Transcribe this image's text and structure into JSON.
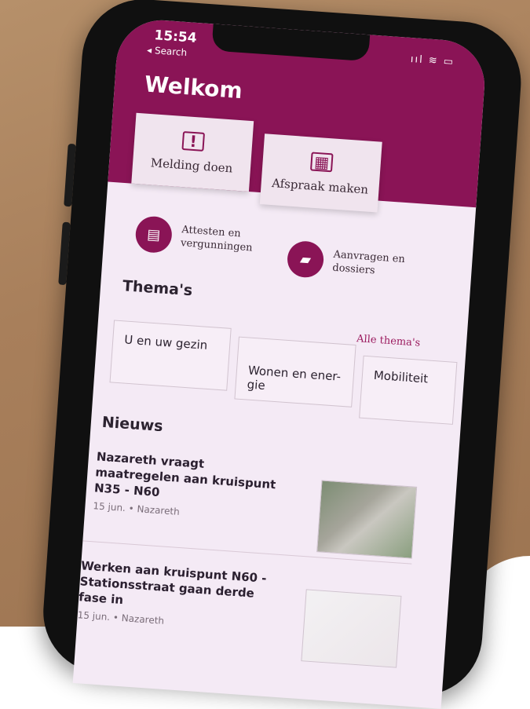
{
  "status": {
    "time": "15:54",
    "back": "◂ Search",
    "icons": "ııl ≋ ▭"
  },
  "header": {
    "title": "Welkom"
  },
  "actions": {
    "melding": "Melding doen",
    "afspraak": "Afspraak maken"
  },
  "quick_links": {
    "attesten": [
      "Attesten en",
      "vergunningen"
    ],
    "aanvragen": [
      "Aanvragen en",
      "dossiers"
    ]
  },
  "themes": {
    "heading": "Thema's",
    "all_link": "Alle thema's",
    "items": [
      "U en uw gezin",
      "Wonen en ener-\ngie",
      "Mobiliteit"
    ]
  },
  "news": {
    "heading": "Nieuws",
    "items": [
      {
        "title": "Nazareth vraagt maatregelen aan kruispunt N35 - N60",
        "meta": "15 jun. • Nazareth"
      },
      {
        "title": "Werken aan kruispunt N60 - Stationsstraat gaan derde fase in",
        "meta": "15 jun. • Nazareth"
      }
    ]
  },
  "colors": {
    "brand": "#8a1456",
    "background": "#f4eaf5"
  },
  "icons": [
    "speech-alert-icon",
    "calendar-icon",
    "certificate-icon",
    "folder-icon",
    "wifi-icon",
    "battery-icon",
    "signal-icon"
  ]
}
